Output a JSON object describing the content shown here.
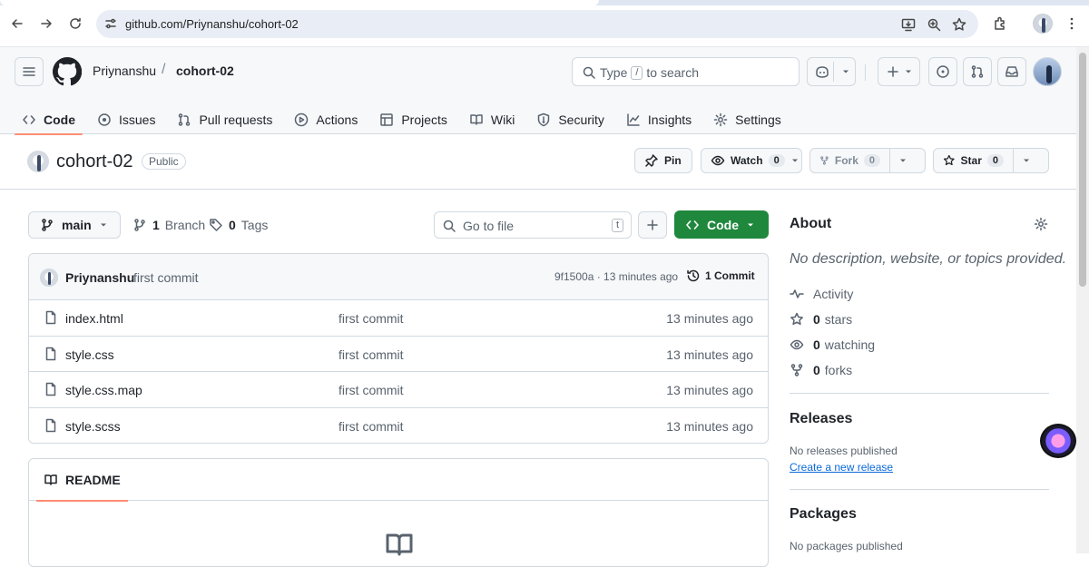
{
  "browser": {
    "url": "github.com/Priynanshu/cohort-02"
  },
  "header": {
    "owner": "Priynanshu",
    "separator": "/",
    "repo": "cohort-02",
    "search_prefix": "Type",
    "search_key": "/",
    "search_suffix": "to search"
  },
  "tabs": [
    {
      "label": "Code",
      "icon": "code-icon",
      "active": true
    },
    {
      "label": "Issues",
      "icon": "issue-icon"
    },
    {
      "label": "Pull requests",
      "icon": "pull-request-icon"
    },
    {
      "label": "Actions",
      "icon": "play-icon"
    },
    {
      "label": "Projects",
      "icon": "table-icon"
    },
    {
      "label": "Wiki",
      "icon": "book-icon"
    },
    {
      "label": "Security",
      "icon": "shield-icon"
    },
    {
      "label": "Insights",
      "icon": "graph-icon"
    },
    {
      "label": "Settings",
      "icon": "gear-icon"
    }
  ],
  "repo_header": {
    "title": "cohort-02",
    "visibility": "Public",
    "pin_label": "Pin",
    "watch_label": "Watch",
    "watch_count": "0",
    "fork_label": "Fork",
    "fork_count": "0",
    "star_label": "Star",
    "star_count": "0"
  },
  "toolbar": {
    "branch": "main",
    "branch_count": "1",
    "branch_label": "Branch",
    "tag_count": "0",
    "tag_label": "Tags",
    "goto_placeholder": "Go to file",
    "goto_key": "t",
    "code_label": "Code"
  },
  "commit": {
    "author": "Priynanshu",
    "message": "first commit",
    "sha_time": "9f1500a · 13 minutes ago",
    "commits_label": "1 Commit"
  },
  "files": [
    {
      "name": "index.html",
      "message": "first commit",
      "time": "13 minutes ago"
    },
    {
      "name": "style.css",
      "message": "first commit",
      "time": "13 minutes ago"
    },
    {
      "name": "style.css.map",
      "message": "first commit",
      "time": "13 minutes ago"
    },
    {
      "name": "style.scss",
      "message": "first commit",
      "time": "13 minutes ago"
    }
  ],
  "readme": {
    "label": "README"
  },
  "about": {
    "heading": "About",
    "description": "No description, website, or topics provided.",
    "activity": "Activity",
    "stars_count": "0",
    "stars_label": "stars",
    "watching_count": "0",
    "watching_label": "watching",
    "forks_count": "0",
    "forks_label": "forks"
  },
  "releases": {
    "heading": "Releases",
    "empty": "No releases published",
    "create_link": "Create a new release"
  },
  "packages": {
    "heading": "Packages",
    "empty": "No packages published"
  },
  "colors": {
    "primary_button": "#1f883d",
    "active_tab_underline": "#fd8c73",
    "link": "#0969da"
  }
}
